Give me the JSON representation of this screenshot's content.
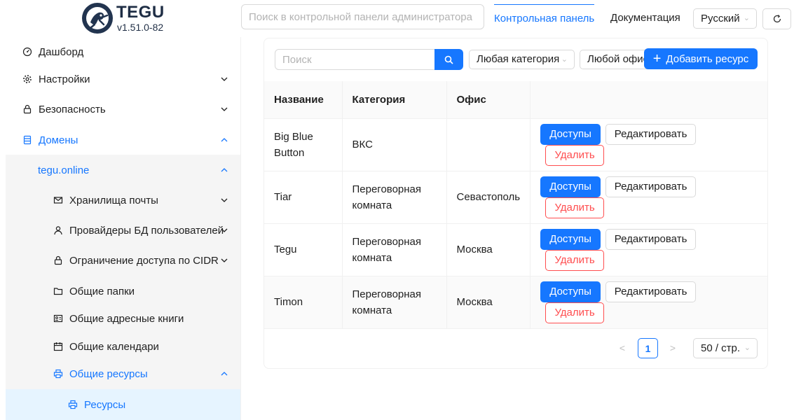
{
  "app": {
    "name": "TEGU",
    "version": "v1.51.0-82"
  },
  "header": {
    "search_placeholder": "Поиск в контрольной панели администратора",
    "tabs": [
      {
        "label": "Контрольная панель",
        "active": true
      },
      {
        "label": "Документация",
        "active": false
      }
    ],
    "language": "Русский",
    "refresh_icon": "refresh-icon"
  },
  "sidebar": {
    "items": [
      {
        "label": "Дашборд",
        "icon": "dashboard-icon"
      },
      {
        "label": "Настройки",
        "icon": "gear-icon",
        "expanded": false
      },
      {
        "label": "Безопасность",
        "icon": "lock-icon",
        "expanded": false
      },
      {
        "label": "Домены",
        "icon": "database-icon",
        "expanded": true
      },
      {
        "label": "tegu.online",
        "expanded": true
      },
      {
        "label": "Хранилища почты",
        "icon": "mail-icon",
        "expanded": false
      },
      {
        "label": "Провайдеры БД пользователей",
        "icon": "user-icon",
        "expanded": false
      },
      {
        "label": "Ограничение доступа по CIDR",
        "icon": "lock-icon",
        "expanded": false
      },
      {
        "label": "Общие папки",
        "icon": "folder-icon"
      },
      {
        "label": "Общие адресные книги",
        "icon": "contact-card-icon"
      },
      {
        "label": "Общие календари",
        "icon": "calendar-icon"
      },
      {
        "label": "Общие ресурсы",
        "icon": "printer-icon",
        "expanded": true
      },
      {
        "label": "Ресурсы",
        "icon": "printer-icon",
        "selected": true
      }
    ]
  },
  "content": {
    "search_placeholder": "Поиск",
    "category_filter": "Любая категория",
    "office_filter": "Любой офис",
    "add_button": "Добавить ресурс",
    "table": {
      "columns": [
        "Название",
        "Категория",
        "Офис",
        ""
      ],
      "rows": [
        {
          "name": "Big Blue Button",
          "category": "ВКС",
          "office": ""
        },
        {
          "name": "Tiar",
          "category": "Переговорная комната",
          "office": "Севастополь"
        },
        {
          "name": "Tegu",
          "category": "Переговорная комната",
          "office": "Москва"
        },
        {
          "name": "Timon",
          "category": "Переговорная комната",
          "office": "Москва"
        }
      ],
      "actions": {
        "access": "Доступы",
        "edit": "Редактировать",
        "delete": "Удалить"
      }
    },
    "pagination": {
      "prev": "<",
      "current_page": "1",
      "next": ">",
      "page_size": "50 / стр."
    }
  },
  "colors": {
    "primary": "#1677ff",
    "danger": "#ff4d4f",
    "text": "#1f1f1f"
  }
}
